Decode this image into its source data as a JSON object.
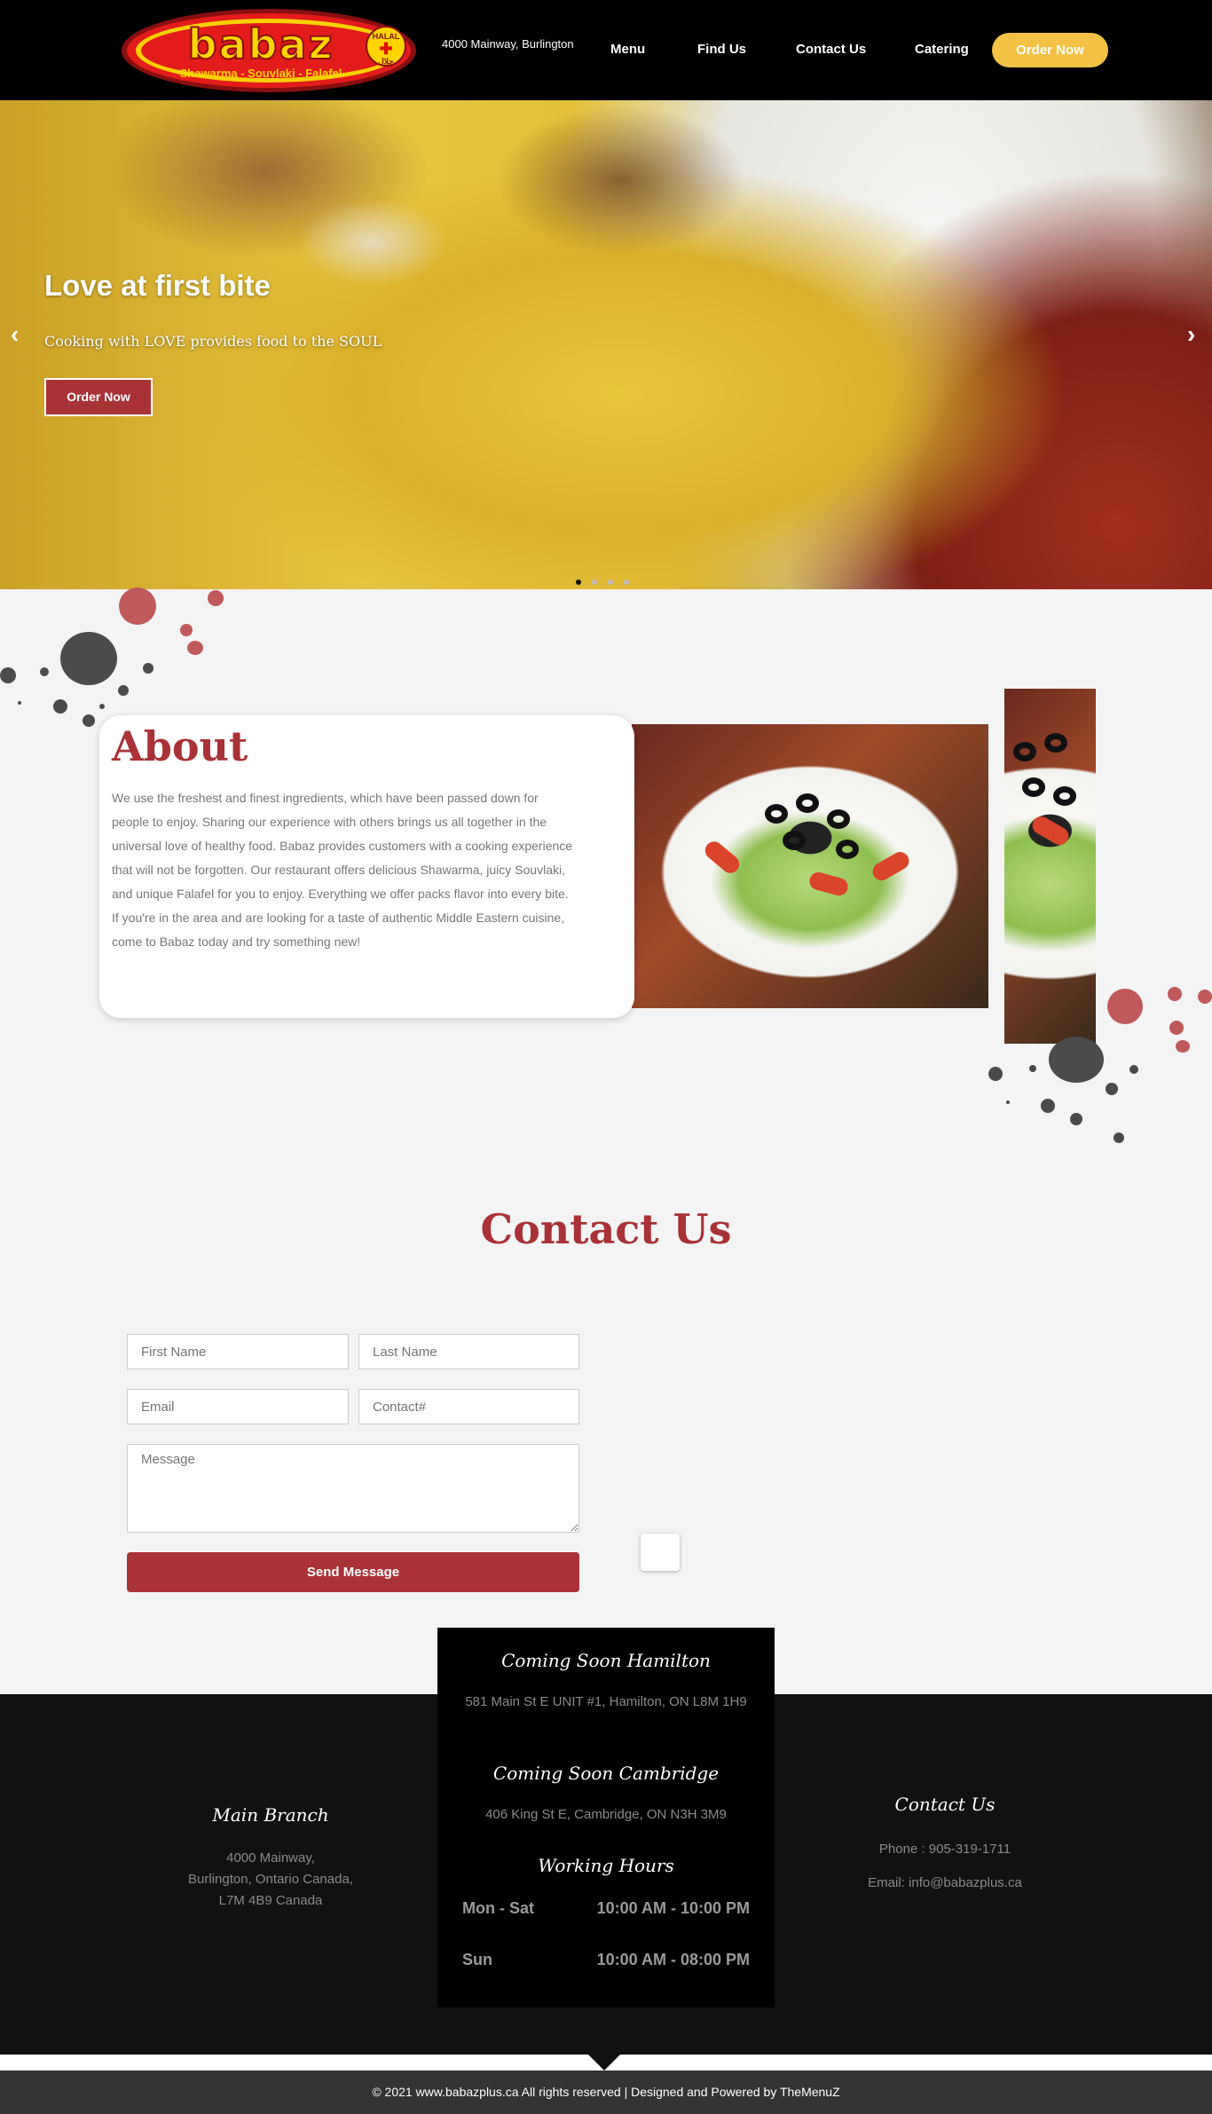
{
  "header": {
    "logo_text": "babaz",
    "logo_tagline": "Shawarma - Souvlaki - Falafel",
    "halal_label": "HALAL",
    "halal_arabic": "حلال",
    "address": "4000 Mainway, Burlington",
    "nav": [
      {
        "label": "Menu"
      },
      {
        "label": "Find Us"
      },
      {
        "label": "Contact Us"
      },
      {
        "label": "Catering"
      }
    ],
    "order_label": "Order Now"
  },
  "hero": {
    "title": "Love at first bite",
    "subtitle": "Cooking with LOVE provides food to the SOUL",
    "button_label": "Order Now",
    "prev_icon": "chevron-left-icon",
    "next_icon": "chevron-right-icon",
    "slide_count": 4,
    "active_slide": 1
  },
  "about": {
    "title": "About",
    "body": "We use the freshest and finest ingredients, which have been passed down for people to enjoy. Sharing our experience with others brings us all together in the universal love of healthy food. Babaz provides customers with a cooking experience that will not be forgotten. Our restaurant offers delicious Shawarma, juicy Souvlaki, and unique Falafel for you to enjoy. Everything we offer packs flavor into every bite. If you're in the area and are looking for a taste of authentic Middle Eastern cuisine, come to Babaz today and try something new!"
  },
  "contact": {
    "title": "Contact Us",
    "first_name_placeholder": "First Name",
    "last_name_placeholder": "Last Name",
    "email_placeholder": "Email",
    "contact_placeholder": "Contact#",
    "message_placeholder": "Message",
    "send_label": "Send Message"
  },
  "footer": {
    "hamilton": {
      "title": "Coming Soon Hamilton",
      "address": "581 Main St E UNIT #1, Hamilton, ON L8M 1H9"
    },
    "cambridge": {
      "title": "Coming Soon Cambridge",
      "address": "406 King St E, Cambridge, ON N3H 3M9"
    },
    "hours": {
      "title": "Working Hours",
      "rows": [
        {
          "days": "Mon - Sat",
          "time": "10:00 AM - 10:00 PM"
        },
        {
          "days": "Sun",
          "time": "10:00 AM - 08:00 PM"
        }
      ]
    },
    "main_branch": {
      "title": "Main Branch",
      "line1": "4000 Mainway,",
      "line2": "Burlington, Ontario Canada,",
      "line3": "L7M 4B9 Canada"
    },
    "contact_us": {
      "title": "Contact Us",
      "phone": "Phone : 905-319-1711",
      "email": "Email: info@babazplus.ca"
    },
    "copyright": "© 2021 www.babazplus.ca All rights reserved | Designed and Powered by TheMenuZ"
  },
  "colors": {
    "brand_red": "#a93236",
    "accent_yellow": "#f3c245",
    "header_bg": "#000000",
    "footer_bg": "#111111"
  }
}
